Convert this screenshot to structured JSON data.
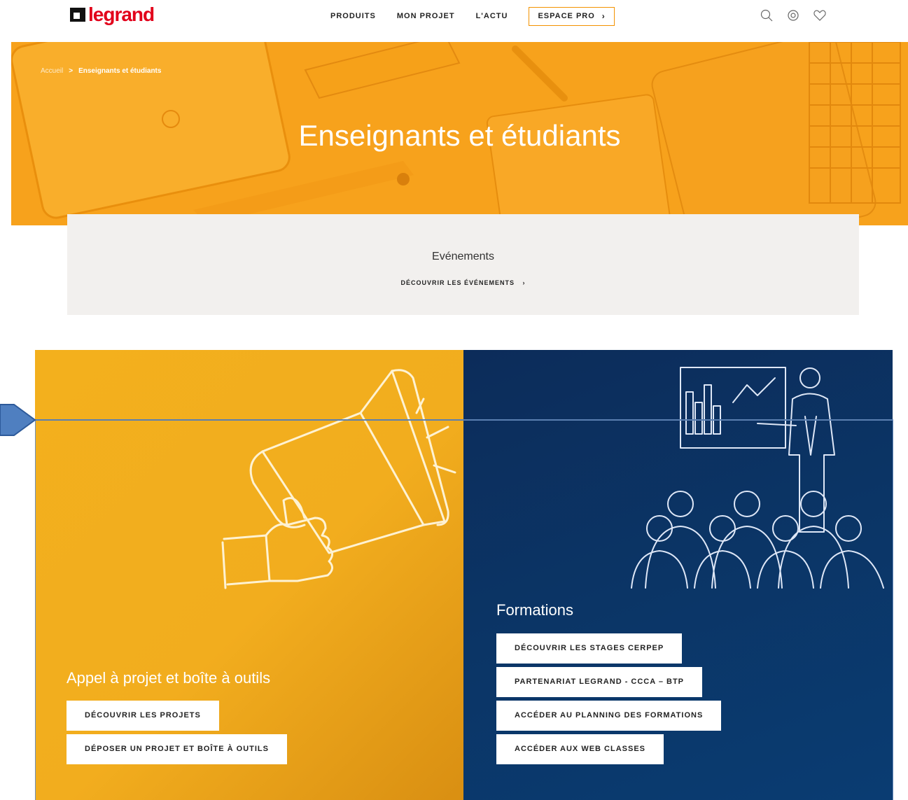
{
  "header": {
    "logo_text": "legrand",
    "nav": [
      "PRODUITS",
      "MON PROJET",
      "L'ACTU"
    ],
    "espace_pro": "ESPACE PRO",
    "espace_pro_chevron": "›",
    "icons": [
      "search-icon",
      "location-icon",
      "heart-icon"
    ]
  },
  "hero": {
    "breadcrumb_home": "Accueil",
    "breadcrumb_sep": ">",
    "breadcrumb_current": "Enseignants et étudiants",
    "title": "Enseignants et étudiants"
  },
  "events": {
    "title": "Evénements",
    "link": "DÉCOUVRIR LES ÉVÉNEMENTS",
    "link_chevron": "›"
  },
  "appel": {
    "title": "Appel à projet et boîte à outils",
    "buttons": [
      "DÉCOUVRIR LES PROJETS",
      "DÉPOSER UN PROJET ET BOÎTE À OUTILS"
    ]
  },
  "formations": {
    "title": "Formations",
    "buttons": [
      "DÉCOUVRIR LES STAGES CERPEP",
      "PARTENARIAT LEGRAND - CCCA – BTP",
      "ACCÉDER AU PLANNING DES FORMATIONS",
      "ACCÉDER AUX WEB CLASSES"
    ]
  },
  "colors": {
    "brand_red": "#e2001a",
    "accent_orange": "#f39200",
    "hero_orange": "#f7a21c",
    "panel_yellow": "#f3b01d",
    "panel_navy": "#0b3566"
  }
}
